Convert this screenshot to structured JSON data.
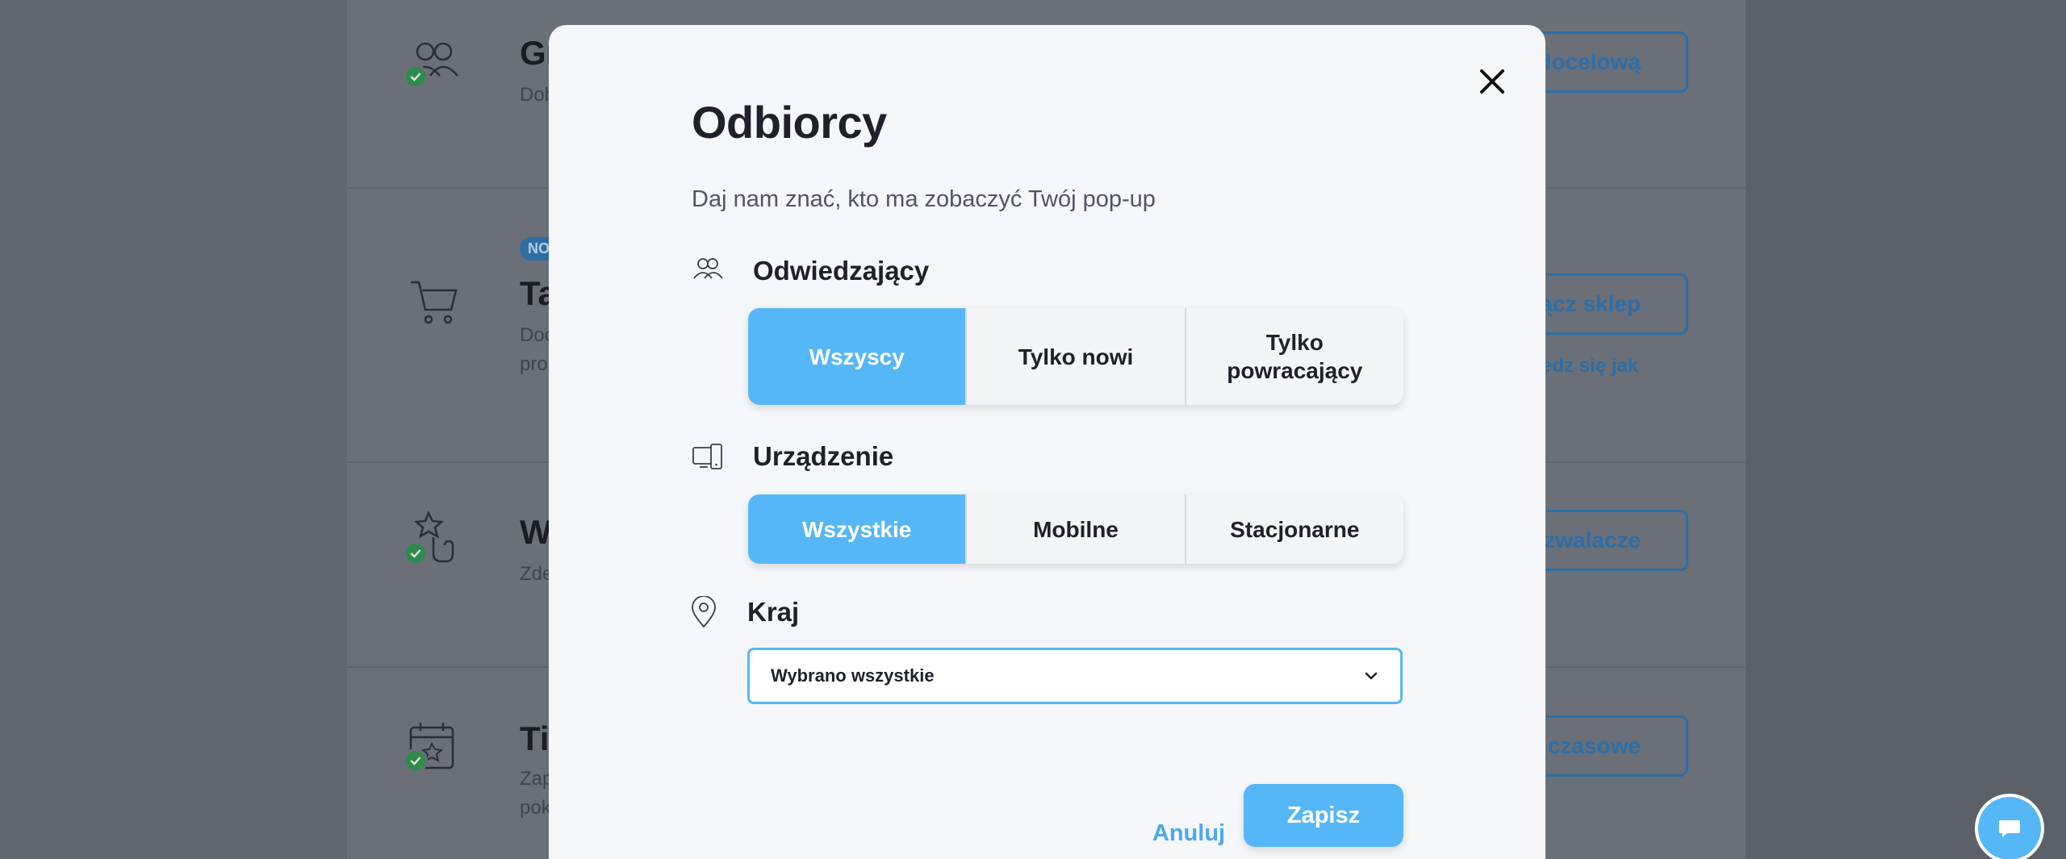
{
  "background": {
    "rows": [
      {
        "title": "Gr",
        "desc": "Dob",
        "button": "docelową",
        "check": true
      },
      {
        "badge": "NO",
        "title": "Ta",
        "desc_lines": [
          "Doc",
          "pro"
        ],
        "button": "ącz sklep",
        "link": "edz się jak",
        "check": false
      },
      {
        "title": "W",
        "desc": "Zde",
        "button": "zwalacze",
        "check": true
      },
      {
        "title": "Ti",
        "desc_lines": [
          "Zap",
          "pok"
        ],
        "button": "czasowe",
        "check": true
      }
    ]
  },
  "modal": {
    "title": "Odbiorcy",
    "subtitle": "Daj nam znać, kto ma zobaczyć Twój pop-up",
    "visitors": {
      "label": "Odwiedzający",
      "icon": "users-icon",
      "options": [
        "Wszyscy",
        "Tylko nowi",
        "Tylko powracający"
      ],
      "selected": "Wszyscy"
    },
    "device": {
      "label": "Urządzenie",
      "icon": "devices-icon",
      "options": [
        "Wszystkie",
        "Mobilne",
        "Stacjonarne"
      ],
      "selected": "Wszystkie"
    },
    "country": {
      "label": "Kraj",
      "icon": "location-pin-icon",
      "value": "Wybrano wszystkie"
    },
    "cancel_label": "Anuluj",
    "save_label": "Zapisz"
  },
  "colors": {
    "accent": "#56b7f7",
    "success": "#2f8a4e",
    "text": "#1d2129"
  }
}
